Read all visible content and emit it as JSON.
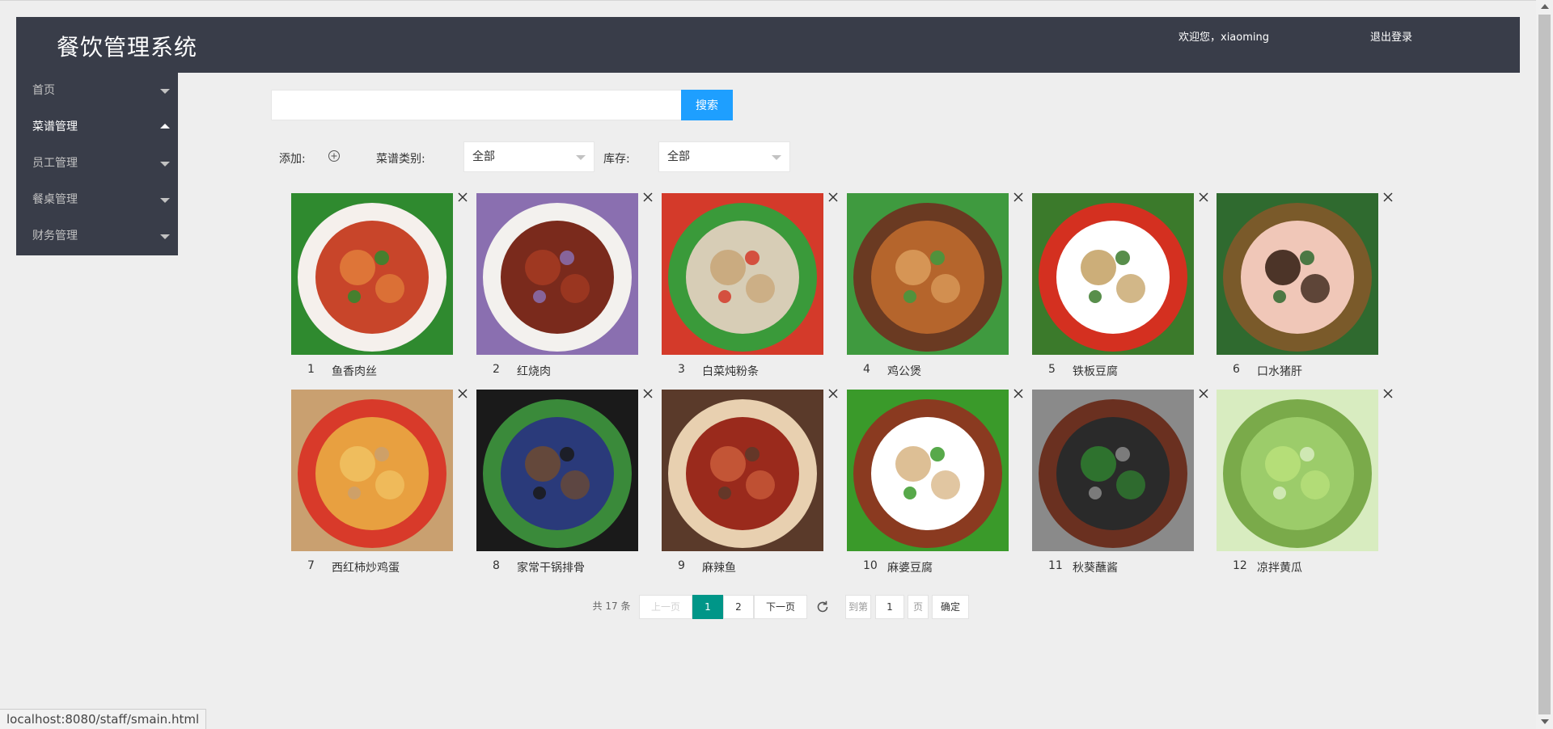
{
  "header": {
    "title": "餐饮管理系统",
    "welcome": "欢迎您，xiaoming",
    "logout": "退出登录"
  },
  "sidebar": {
    "items": [
      {
        "label": "首页",
        "expanded": false
      },
      {
        "label": "菜谱管理",
        "expanded": true
      },
      {
        "label": "员工管理",
        "expanded": false
      },
      {
        "label": "餐桌管理",
        "expanded": false
      },
      {
        "label": "财务管理",
        "expanded": false
      }
    ]
  },
  "search": {
    "value": "",
    "button": "搜索"
  },
  "filters": {
    "add_label": "添加:",
    "category_label": "菜谱类别:",
    "category_value": "全部",
    "stock_label": "库存:",
    "stock_value": "全部"
  },
  "dishes": [
    {
      "num": "1",
      "name": "鱼香肉丝",
      "colors": [
        "#c8452a",
        "#e07a3a",
        "#f5f0ec",
        "#2f8a2f"
      ]
    },
    {
      "num": "2",
      "name": "红烧肉",
      "colors": [
        "#7a2a1c",
        "#a33a22",
        "#f3f1ee",
        "#8a6fb0"
      ]
    },
    {
      "num": "3",
      "name": "白菜炖粉条",
      "colors": [
        "#d7cdb6",
        "#c9a77a",
        "#3a9a3a",
        "#d43a2a"
      ]
    },
    {
      "num": "4",
      "name": "鸡公煲",
      "colors": [
        "#b5652c",
        "#d99a5a",
        "#6a3a22",
        "#3f9a3f"
      ]
    },
    {
      "num": "5",
      "name": "铁板豆腐",
      "colors": [
        "#ffffff",
        "#c7a56a",
        "#d43020",
        "#3b7a2b"
      ]
    },
    {
      "num": "6",
      "name": "口水猪肝",
      "colors": [
        "#f0c7b8",
        "#3a2418",
        "#7a5a2a",
        "#2f6a2f"
      ]
    },
    {
      "num": "7",
      "name": "西红柿炒鸡蛋",
      "colors": [
        "#e8a040",
        "#f0c060",
        "#d83a2a",
        "#c9a070"
      ]
    },
    {
      "num": "8",
      "name": "家常干锅排骨",
      "colors": [
        "#2a3a7a",
        "#6a4a34",
        "#3a8a3a",
        "#1a1a1a"
      ]
    },
    {
      "num": "9",
      "name": "麻辣鱼",
      "colors": [
        "#9a2a1c",
        "#c85a3a",
        "#e8d0b0",
        "#5a3a2a"
      ]
    },
    {
      "num": "10",
      "name": "麻婆豆腐",
      "colors": [
        "#ffffff",
        "#d9b88a",
        "#8a3a20",
        "#3a9a2a"
      ]
    },
    {
      "num": "11",
      "name": "秋葵蘸酱",
      "colors": [
        "#2a2a2a",
        "#2f7a2f",
        "#6a3020",
        "#8a8a8a"
      ]
    },
    {
      "num": "12",
      "name": "凉拌黄瓜",
      "colors": [
        "#9ccc6a",
        "#b8e07a",
        "#7aaa4a",
        "#d8ecc0"
      ]
    }
  ],
  "pagination": {
    "total": "共 17 条",
    "prev": "上一页",
    "pages": [
      "1",
      "2"
    ],
    "current": "1",
    "next": "下一页",
    "goto_label": "到第",
    "goto_value": "1",
    "page_unit": "页",
    "confirm": "确定"
  },
  "statusbar": {
    "url": "localhost:8080/staff/smain.html"
  },
  "colors": {
    "header_bg": "#393d49",
    "accent": "#1e9fff",
    "current_page": "#009688"
  }
}
